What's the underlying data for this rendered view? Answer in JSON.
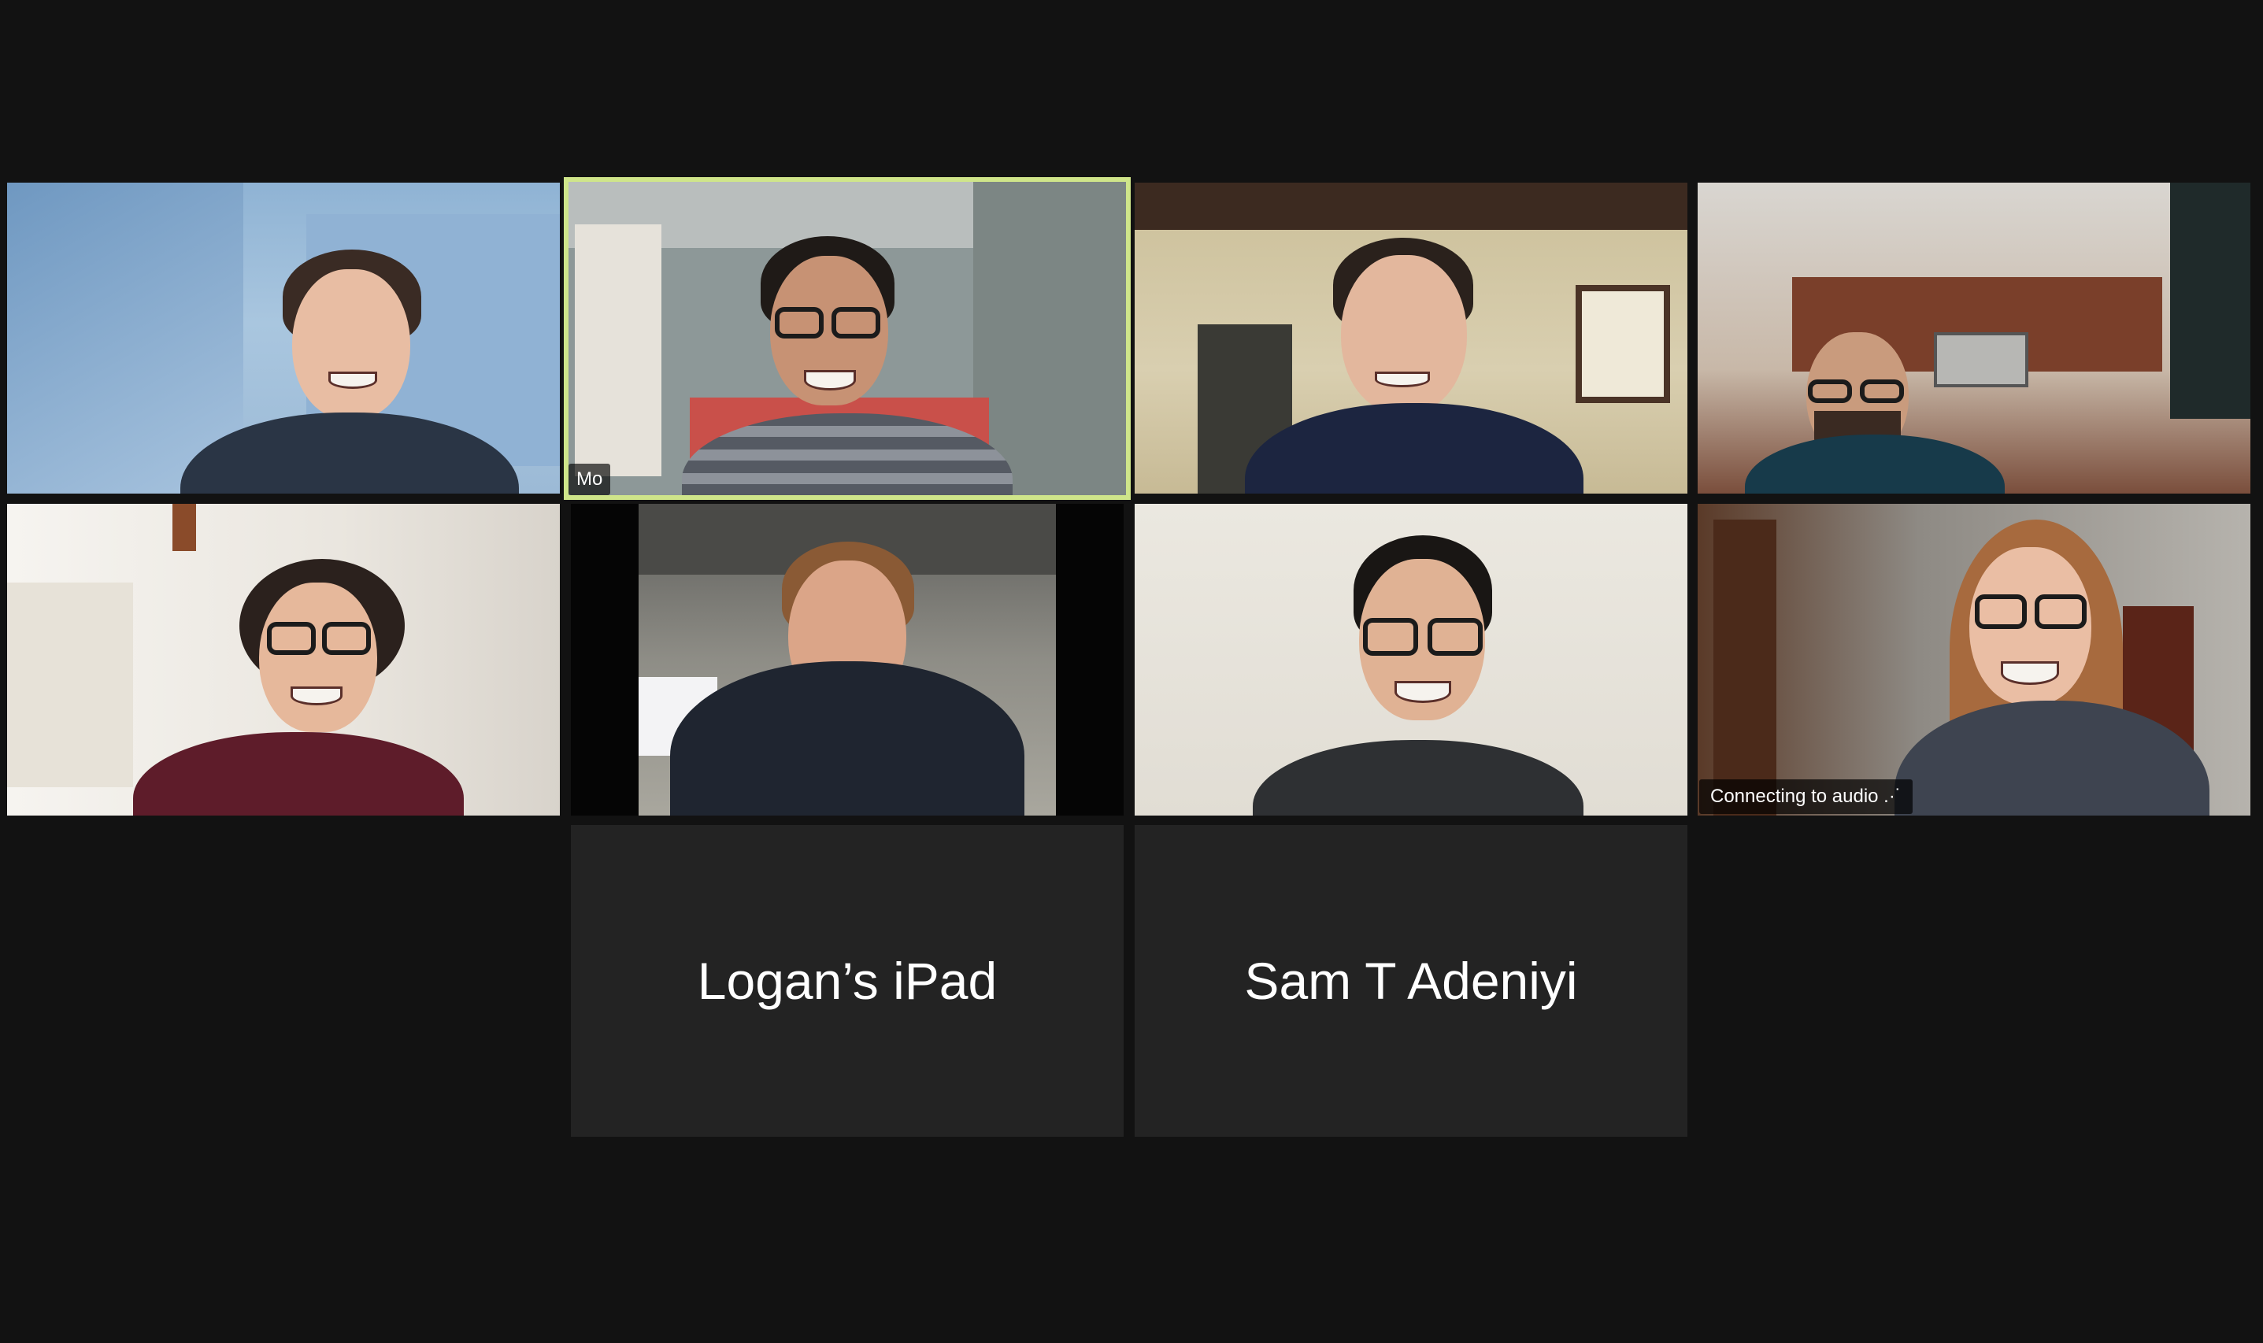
{
  "meeting": {
    "active_speaker_label": "Mo",
    "audio_status": "Connecting to audio",
    "audio_status_icon": "ellipsis-icon",
    "audio_only_participants": [
      {
        "display_name": "Logan’s iPad"
      },
      {
        "display_name": "Sam T Adeniyi"
      }
    ]
  },
  "colors": {
    "background": "#121212",
    "tile_placeholder": "#232323",
    "active_speaker_border": "#cfe58a"
  }
}
